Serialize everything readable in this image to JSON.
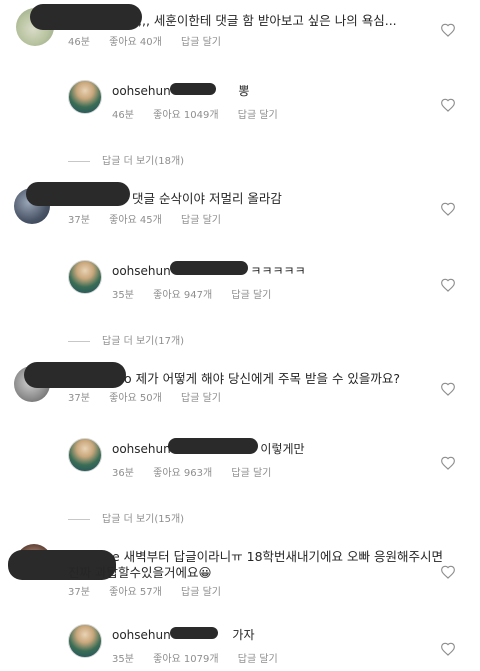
{
  "comments": [
    {
      "text": ",,, 세훈이한테 댓글 함 받아보고 싶은 나의 욕심...",
      "time": "46분",
      "likes": "좋아요 40개",
      "reply": "답글 달기"
    },
    {
      "username": "oohsehun",
      "text": "뽕",
      "time": "46분",
      "likes": "좋아요 1049개",
      "reply": "답글 달기"
    },
    {
      "more": "답글 더 보기(18개)"
    },
    {
      "text": "댓글 순삭이야 저멀리 올라감",
      "time": "37분",
      "likes": "좋아요 45개",
      "reply": "답글 달기"
    },
    {
      "username": "oohsehun",
      "text": "ㅋㅋㅋㅋㅋ",
      "time": "35분",
      "likes": "좋아요 947개",
      "reply": "답글 달기"
    },
    {
      "more": "답글 더 보기(17개)"
    },
    {
      "text": "o 제가 어떻게 해야 당신에게 주목 받을 수 있을까요?",
      "time": "37분",
      "likes": "좋아요 50개",
      "reply": "답글 달기"
    },
    {
      "username": "oohsehun",
      "text": "이렇게만",
      "time": "36분",
      "likes": "좋아요 963개",
      "reply": "답글 달기"
    },
    {
      "more": "답글 더 보기(15개)"
    },
    {
      "text_line1": "e 새벽부터 답글이라니ㅠ 18학번새내기에요 오빠 응원해주시면",
      "text_line2": "진짜 과탑할수있을거에요😀",
      "time": "37분",
      "likes": "좋아요 57개",
      "reply": "답글 달기"
    },
    {
      "username": "oohsehun",
      "text": "가자",
      "time": "35분",
      "likes": "좋아요 1079개",
      "reply": "답글 달기"
    }
  ]
}
